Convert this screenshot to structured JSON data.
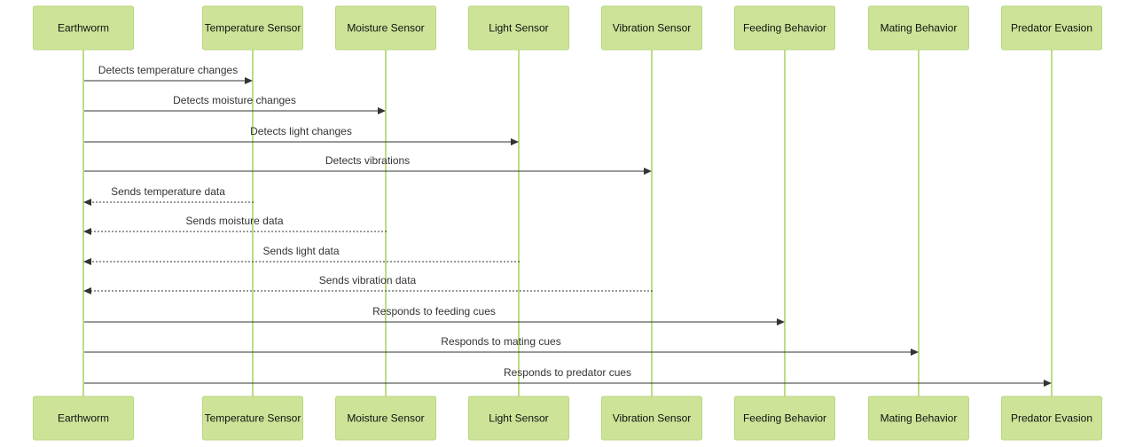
{
  "colors": {
    "participant_fill": "#cde498",
    "participant_border": "#b8d67f",
    "lifeline": "#a9d05a",
    "message": "#333333"
  },
  "participants": [
    "Earthworm",
    "Temperature Sensor",
    "Moisture Sensor",
    "Light Sensor",
    "Vibration Sensor",
    "Feeding Behavior",
    "Mating Behavior",
    "Predator Evasion"
  ],
  "messages": [
    {
      "from": 0,
      "to": 1,
      "label": "Detects temperature changes",
      "style": "solid"
    },
    {
      "from": 0,
      "to": 2,
      "label": "Detects moisture changes",
      "style": "solid"
    },
    {
      "from": 0,
      "to": 3,
      "label": "Detects light changes",
      "style": "solid"
    },
    {
      "from": 0,
      "to": 4,
      "label": "Detects vibrations",
      "style": "solid"
    },
    {
      "from": 1,
      "to": 0,
      "label": "Sends temperature data",
      "style": "dashed"
    },
    {
      "from": 2,
      "to": 0,
      "label": "Sends moisture data",
      "style": "dashed"
    },
    {
      "from": 3,
      "to": 0,
      "label": "Sends light data",
      "style": "dashed"
    },
    {
      "from": 4,
      "to": 0,
      "label": "Sends vibration data",
      "style": "dashed"
    },
    {
      "from": 0,
      "to": 5,
      "label": "Responds to feeding cues",
      "style": "solid"
    },
    {
      "from": 0,
      "to": 6,
      "label": "Responds to mating cues",
      "style": "solid"
    },
    {
      "from": 0,
      "to": 7,
      "label": "Responds to predator cues",
      "style": "solid"
    }
  ]
}
